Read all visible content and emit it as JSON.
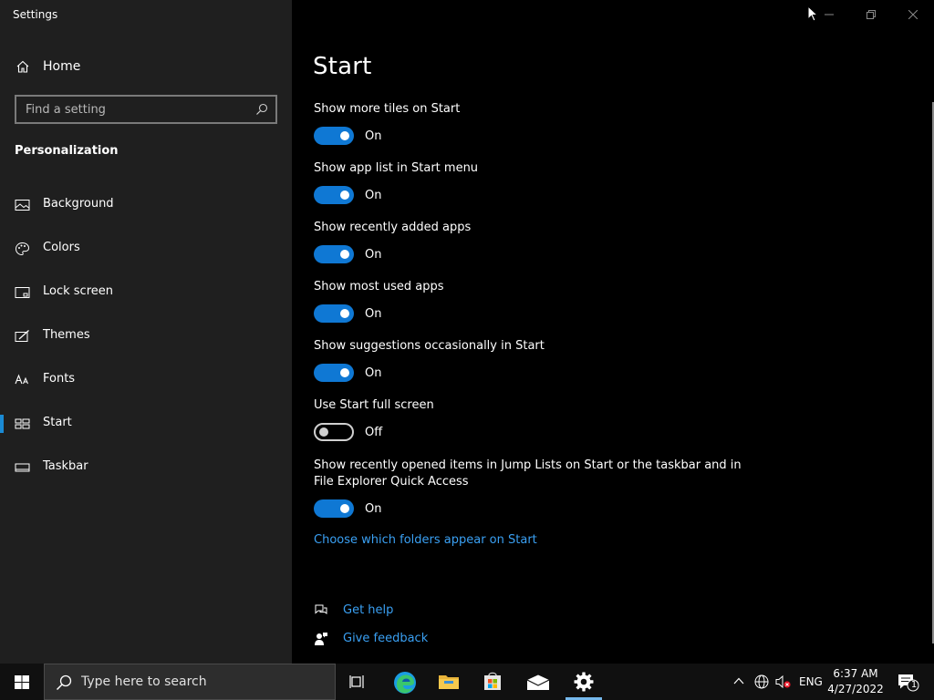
{
  "window": {
    "title": "Settings"
  },
  "sidebar": {
    "home_label": "Home",
    "search_placeholder": "Find a setting",
    "section": "Personalization",
    "items": [
      {
        "label": "Background",
        "icon": "picture-icon"
      },
      {
        "label": "Colors",
        "icon": "palette-icon"
      },
      {
        "label": "Lock screen",
        "icon": "lock-screen-icon"
      },
      {
        "label": "Themes",
        "icon": "themes-icon"
      },
      {
        "label": "Fonts",
        "icon": "fonts-icon"
      },
      {
        "label": "Start",
        "icon": "start-icon",
        "active": true
      },
      {
        "label": "Taskbar",
        "icon": "taskbar-icon"
      }
    ]
  },
  "main": {
    "title": "Start",
    "settings": [
      {
        "label": "Show more tiles on Start",
        "on": true,
        "state": "On"
      },
      {
        "label": "Show app list in Start menu",
        "on": true,
        "state": "On"
      },
      {
        "label": "Show recently added apps",
        "on": true,
        "state": "On"
      },
      {
        "label": "Show most used apps",
        "on": true,
        "state": "On"
      },
      {
        "label": "Show suggestions occasionally in Start",
        "on": true,
        "state": "On"
      },
      {
        "label": "Use Start full screen",
        "on": false,
        "state": "Off"
      },
      {
        "label": "Show recently opened items in Jump Lists on Start or the taskbar and in File Explorer Quick Access",
        "on": true,
        "state": "On"
      }
    ],
    "folders_link": "Choose which folders appear on Start",
    "get_help": "Get help",
    "give_feedback": "Give feedback"
  },
  "taskbar": {
    "search_placeholder": "Type here to search",
    "language": "ENG",
    "time": "6:37 AM",
    "date": "4/27/2022",
    "notification_count": "1"
  },
  "colors": {
    "accent": "#0f78d4",
    "link": "#3aa0f3",
    "sidebar_bg": "#1f1f1f",
    "main_bg": "#000000"
  }
}
